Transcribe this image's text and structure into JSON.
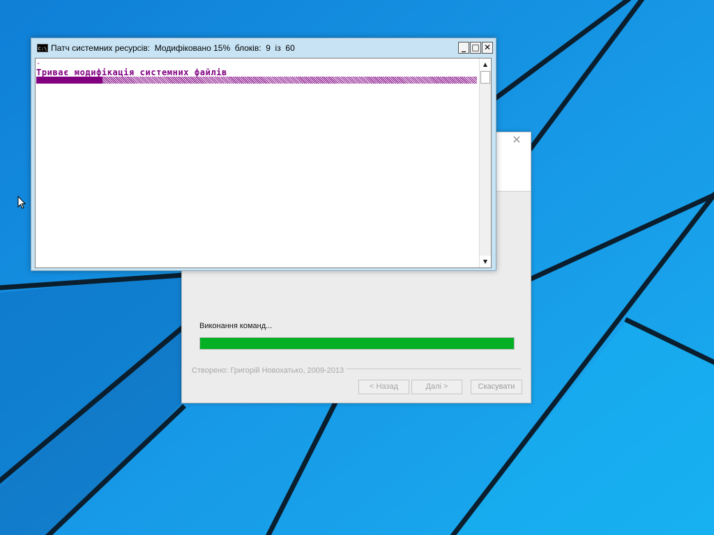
{
  "colors": {
    "desktop_blue": "#1a8fe0",
    "console_text": "#800080",
    "progress_green": "#06b025"
  },
  "icons": {
    "console_app_icon": "cmd-icon",
    "cursor": "mouse-pointer-icon"
  },
  "console": {
    "icon_text": "C:\\",
    "title": "Патч системних ресурсів:  Модифіковано 15%  блоків:  9  із  60",
    "min_label": "_",
    "max_label": "□",
    "close_label": "✕",
    "cursor_char": "-",
    "message": "Триває модифікація системних файлів",
    "progress": 0.15,
    "scroll_up": "▲",
    "scroll_down": "▼"
  },
  "installer": {
    "close_label": "✕",
    "status_text": "Виконання команд...",
    "progress": 1.0,
    "credit": "Створено: Григорій Новохатько, 2009-2013",
    "buttons": {
      "back": "< Назад",
      "next": "Далі >",
      "cancel": "Скасувати"
    }
  }
}
